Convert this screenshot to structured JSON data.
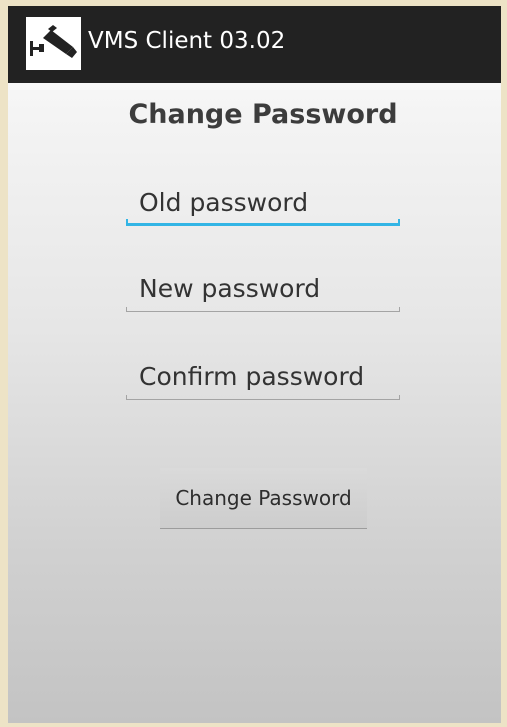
{
  "app": {
    "title": "VMS Client 03.02",
    "icon": "security-camera-icon"
  },
  "screen": {
    "heading": "Change Password"
  },
  "form": {
    "old_password": {
      "placeholder": "Old password",
      "value": "",
      "focused": true
    },
    "new_password": {
      "placeholder": "New password",
      "value": ""
    },
    "confirm_password": {
      "placeholder": "Confirm password",
      "value": ""
    }
  },
  "actions": {
    "submit_label": "Change Password"
  },
  "colors": {
    "action_bar": "#222222",
    "focus_accent": "#33b5e5"
  }
}
